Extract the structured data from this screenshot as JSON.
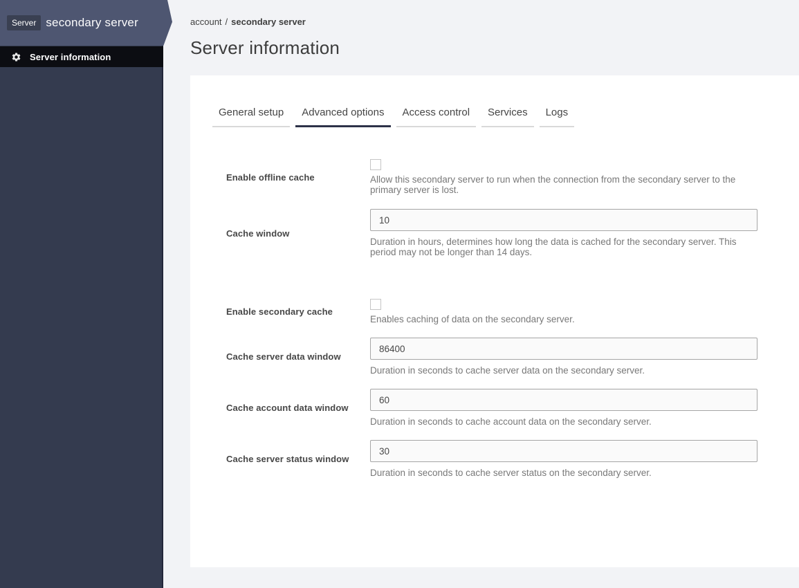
{
  "sidebar": {
    "badge_label": "Server",
    "server_name": "secondary server",
    "nav_items": [
      {
        "icon": "gear-icon",
        "label": "Server information"
      }
    ]
  },
  "breadcrumb": {
    "parent": "account",
    "separator": "/",
    "current": "secondary server"
  },
  "page": {
    "title": "Server information"
  },
  "tabs": [
    {
      "label": "General setup",
      "active": false
    },
    {
      "label": "Advanced options",
      "active": true
    },
    {
      "label": "Access control",
      "active": false
    },
    {
      "label": "Services",
      "active": false
    },
    {
      "label": "Logs",
      "active": false
    }
  ],
  "form": {
    "fields": [
      {
        "type": "checkbox",
        "label": "Enable offline cache",
        "checked": false,
        "description": "Allow this secondary server to run when the connection from the secondary server to the primary server is lost."
      },
      {
        "type": "text",
        "label": "Cache window",
        "value": "10",
        "description": "Duration in hours, determines how long the data is cached for the secondary server. This period may not be longer than 14 days."
      },
      {
        "type": "checkbox",
        "label": "Enable secondary cache",
        "checked": false,
        "description": "Enables caching of data on the secondary server."
      },
      {
        "type": "text",
        "label": "Cache server data window",
        "value": "86400",
        "description": "Duration in seconds to cache server data on the secondary server."
      },
      {
        "type": "text",
        "label": "Cache account data window",
        "value": "60",
        "description": "Duration in seconds to cache account data on the secondary server."
      },
      {
        "type": "text",
        "label": "Cache server status window",
        "value": "30",
        "description": "Duration in seconds to cache server status on the secondary server."
      }
    ]
  },
  "colors": {
    "sidebar_header": "#4e5671",
    "sidebar_body": "#343b4f",
    "sidebar_nav_active": "#0c0d12",
    "badge_bg": "#3a4052",
    "page_bg": "#f2f3f6",
    "card_bg": "#ffffff",
    "tab_active_underline": "#2d3248",
    "tab_inactive_underline": "#d9d9d9",
    "input_bg": "#fafafa",
    "input_border": "#a5a5a5",
    "description_text": "#787878"
  }
}
